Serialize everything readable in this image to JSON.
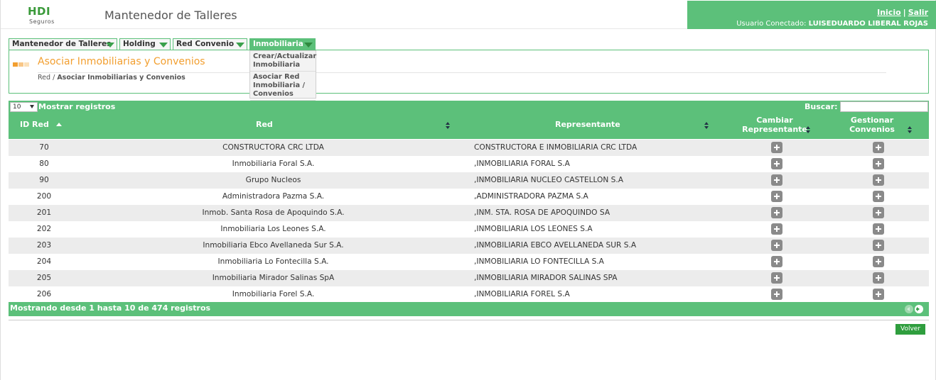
{
  "header": {
    "logo_brand": "HDI",
    "logo_sub": "Seguros",
    "app_title": "Mantenedor de Talleres",
    "link_inicio": "Inicio",
    "link_sep": "|",
    "link_salir": "Salir",
    "user_label": "Usuario Conectado:",
    "user_name": "LUISEDUARDO LIBERAL ROJAS",
    "accent_color": "#5cc07a"
  },
  "menu": {
    "items": [
      {
        "label": "Mantenedor de Talleres"
      },
      {
        "label": "Holding"
      },
      {
        "label": "Red Convenio"
      },
      {
        "label": "Inmobiliaria",
        "active": true
      }
    ],
    "dropdown": [
      {
        "label": "Crear/Actualizar Inmobiliaria"
      },
      {
        "label": "Asociar Red Inmobiliaria / Convenios"
      }
    ]
  },
  "section": {
    "title": "Asociar Inmobiliarias y Convenios",
    "breadcrumb_root": "Red",
    "breadcrumb_sep": "/",
    "breadcrumb_current": "Asociar Inmobiliarias y Convenios",
    "title_color": "#f29f30"
  },
  "table": {
    "length_value": "10",
    "length_label": "Mostrar registros",
    "search_label": "Buscar:",
    "search_value": "",
    "columns": {
      "id": "ID Red",
      "red": "Red",
      "rep": "Representante",
      "cambiar": "Cambiar Representante",
      "gestionar": "Gestionar Convenios"
    },
    "rows": [
      {
        "id": "70",
        "red": "CONSTRUCTORA CRC LTDA",
        "rep": "CONSTRUCTORA E INMOBILIARIA CRC LTDA"
      },
      {
        "id": "80",
        "red": "Inmobiliaria Foral S.A.",
        "rep": ",INMOBILIARIA FORAL S.A"
      },
      {
        "id": "90",
        "red": "Grupo Nucleos",
        "rep": ",INMOBILIARIA NUCLEO CASTELLON S.A"
      },
      {
        "id": "200",
        "red": "Administradora Pazma S.A.",
        "rep": ",ADMINISTRADORA PAZMA S.A"
      },
      {
        "id": "201",
        "red": "Inmob. Santa Rosa de Apoquindo S.A.",
        "rep": ",INM. STA. ROSA DE APOQUINDO SA"
      },
      {
        "id": "202",
        "red": "Inmobiliaria Los Leones S.A.",
        "rep": ",INMOBILIARIA LOS LEONES S.A"
      },
      {
        "id": "203",
        "red": "Inmobiliaria Ebco Avellaneda Sur S.A.",
        "rep": ",INMOBILIARIA EBCO AVELLANEDA SUR S.A"
      },
      {
        "id": "204",
        "red": "Inmobiliaria Lo Fontecilla S.A.",
        "rep": ",INMOBILIARIA LO FONTECILLA S.A"
      },
      {
        "id": "205",
        "red": "Inmobiliaria Mirador Salinas SpA",
        "rep": ",INMOBILIARIA MIRADOR SALINAS SPA"
      },
      {
        "id": "206",
        "red": "Inmobiliaria Forel S.A.",
        "rep": ",INMOBILIARIA FOREL S.A"
      }
    ],
    "info": "Mostrando desde 1 hasta 10 de 474 registros"
  },
  "footer": {
    "volver_label": "Volver"
  },
  "icons": {
    "row_action": "plus-icon",
    "prev": "arrow-left-icon",
    "next": "arrow-right-icon"
  }
}
